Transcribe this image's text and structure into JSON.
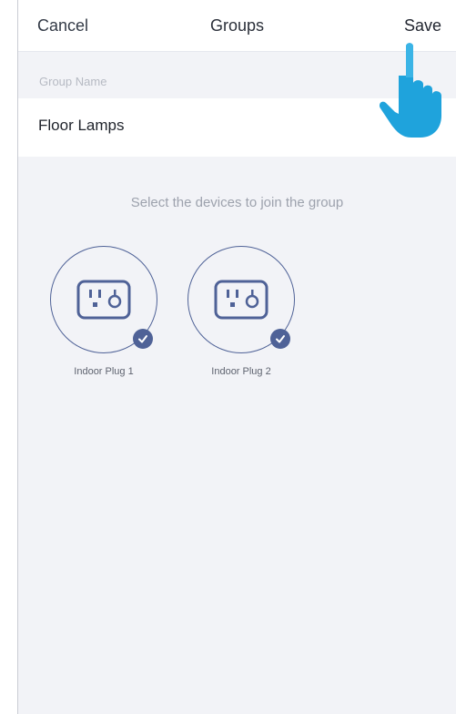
{
  "nav": {
    "cancel_label": "Cancel",
    "title": "Groups",
    "save_label": "Save"
  },
  "group_name": {
    "label": "Group Name",
    "value": "Floor Lamps"
  },
  "instruction": "Select the devices to join the group",
  "devices": [
    {
      "label": "Indoor Plug 1",
      "selected": true,
      "icon": "outlet-icon"
    },
    {
      "label": "Indoor Plug 2",
      "selected": true,
      "icon": "outlet-icon"
    }
  ],
  "colors": {
    "accent": "#4f6297",
    "background": "#f2f3f7",
    "hand": "#1fa3dc"
  }
}
